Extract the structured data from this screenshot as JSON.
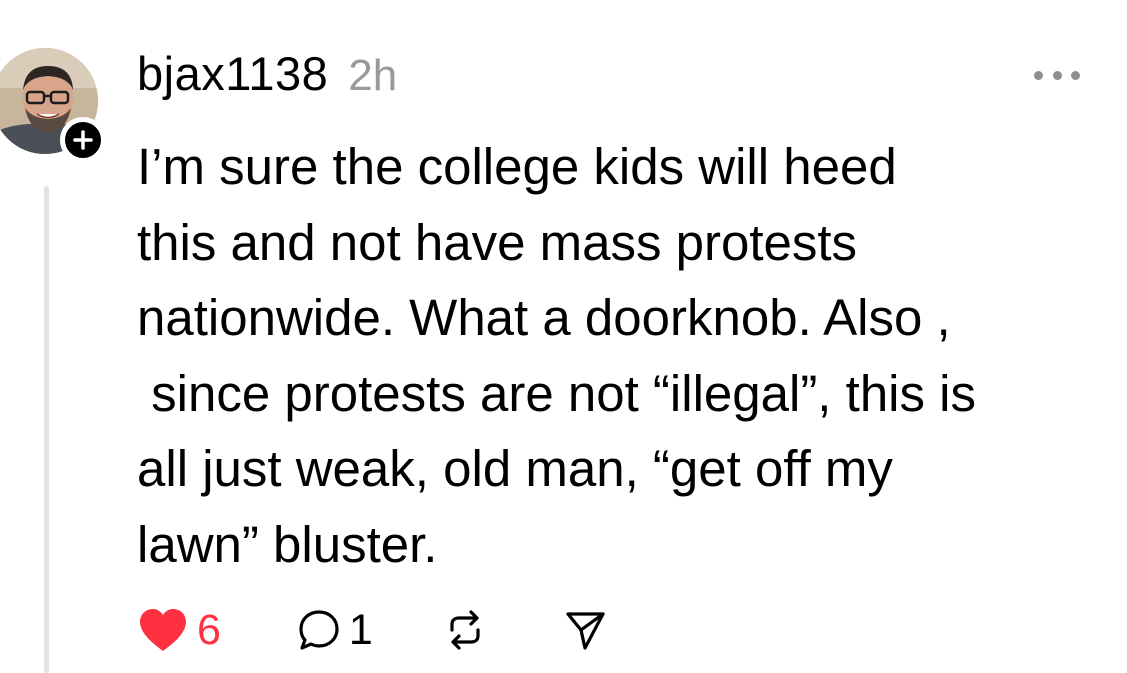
{
  "post": {
    "username": "bjax1138",
    "timestamp": "2h",
    "text": "I’m sure the college kids will heed\nthis and not have mass protests\nnationwide. What a doorknob. Also ,\n since protests are not “illegal”, this is\nall just weak, old man, “get off my\nlawn” bluster.",
    "likes": "6",
    "replies": "1"
  },
  "icons": {
    "avatar": "user-photo-avatar",
    "follow": "plus-icon",
    "more": "ellipsis-icon",
    "like": "heart-icon",
    "reply": "speech-bubble-icon",
    "repost": "repost-icon",
    "share": "send-icon"
  },
  "colors": {
    "like_active": "#ff3040",
    "timestamp": "#999999",
    "thread_line": "#e3e3e3"
  }
}
